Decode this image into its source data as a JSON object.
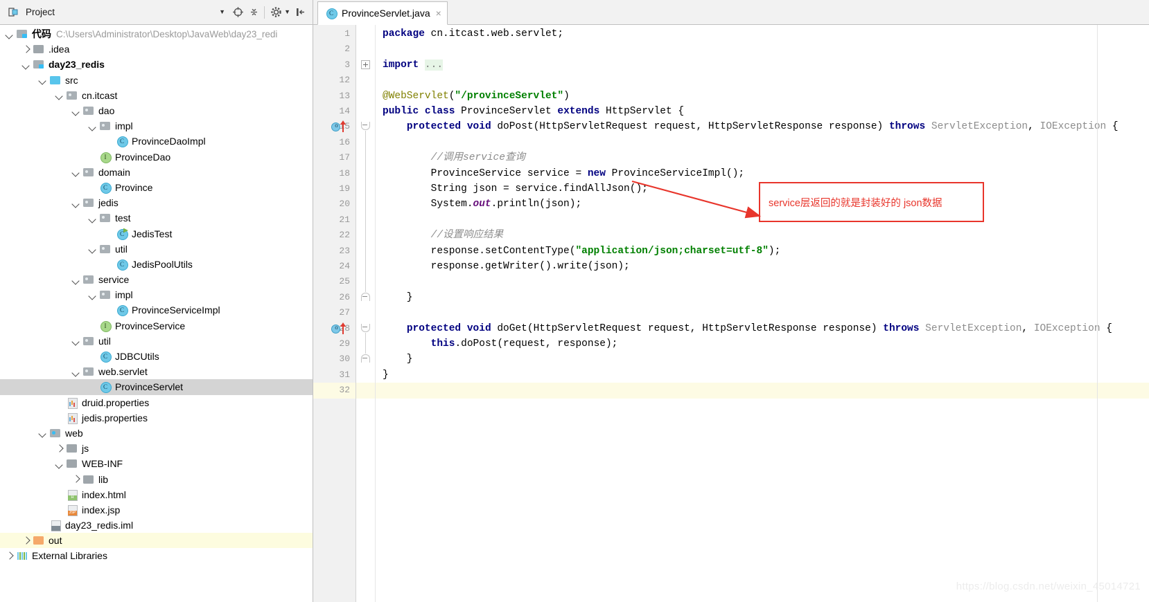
{
  "window": {
    "tool_window_title": "Project",
    "watermark": "https://blog.csdn.net/weixin_45014721"
  },
  "toolbar": {
    "locate_icon": "crosshair-locate-icon",
    "collapse_icon": "collapse-all-icon",
    "settings_icon": "gear-icon",
    "hide_icon": "hide-tool-window-icon",
    "caret_icon": "chevron-down-icon"
  },
  "tabs": [
    {
      "label": "ProvinceServlet.java",
      "icon": "java-class-icon",
      "active": true,
      "close": "×"
    }
  ],
  "tree": [
    {
      "label": "代码",
      "path": "C:\\Users\\Administrator\\Desktop\\JavaWeb\\day23_redi",
      "indent": 0,
      "arrow": "down",
      "icon": "mod",
      "bold": true
    },
    {
      "label": ".idea",
      "indent": 1,
      "arrow": "right",
      "icon": "folder"
    },
    {
      "label": "day23_redis",
      "indent": 1,
      "arrow": "down",
      "icon": "mod",
      "bold": true
    },
    {
      "label": "src",
      "indent": 2,
      "arrow": "down",
      "icon": "srcfolder"
    },
    {
      "label": "cn.itcast",
      "indent": 3,
      "arrow": "down",
      "icon": "pkg"
    },
    {
      "label": "dao",
      "indent": 4,
      "arrow": "down",
      "icon": "pkg"
    },
    {
      "label": "impl",
      "indent": 5,
      "arrow": "down",
      "icon": "pkg"
    },
    {
      "label": "ProvinceDaoImpl",
      "indent": 6,
      "arrow": "none",
      "icon": "cls"
    },
    {
      "label": "ProvinceDao",
      "indent": 5,
      "arrow": "none",
      "icon": "iface"
    },
    {
      "label": "domain",
      "indent": 4,
      "arrow": "down",
      "icon": "pkg"
    },
    {
      "label": "Province",
      "indent": 5,
      "arrow": "none",
      "icon": "cls"
    },
    {
      "label": "jedis",
      "indent": 4,
      "arrow": "down",
      "icon": "pkg"
    },
    {
      "label": "test",
      "indent": 5,
      "arrow": "down",
      "icon": "pkg"
    },
    {
      "label": "JedisTest",
      "indent": 6,
      "arrow": "none",
      "icon": "clsrun"
    },
    {
      "label": "util",
      "indent": 5,
      "arrow": "down",
      "icon": "pkg"
    },
    {
      "label": "JedisPoolUtils",
      "indent": 6,
      "arrow": "none",
      "icon": "cls"
    },
    {
      "label": "service",
      "indent": 4,
      "arrow": "down",
      "icon": "pkg"
    },
    {
      "label": "impl",
      "indent": 5,
      "arrow": "down",
      "icon": "pkg"
    },
    {
      "label": "ProvinceServiceImpl",
      "indent": 6,
      "arrow": "none",
      "icon": "cls"
    },
    {
      "label": "ProvinceService",
      "indent": 5,
      "arrow": "none",
      "icon": "iface"
    },
    {
      "label": "util",
      "indent": 4,
      "arrow": "down",
      "icon": "pkg"
    },
    {
      "label": "JDBCUtils",
      "indent": 5,
      "arrow": "none",
      "icon": "cls"
    },
    {
      "label": "web.servlet",
      "indent": 4,
      "arrow": "down",
      "icon": "pkg"
    },
    {
      "label": "ProvinceServlet",
      "indent": 5,
      "arrow": "none",
      "icon": "cls",
      "state": "selected"
    },
    {
      "label": "druid.properties",
      "indent": 3,
      "arrow": "none",
      "icon": "props"
    },
    {
      "label": "jedis.properties",
      "indent": 3,
      "arrow": "none",
      "icon": "props"
    },
    {
      "label": "web",
      "indent": 2,
      "arrow": "down",
      "icon": "webfolder"
    },
    {
      "label": "js",
      "indent": 3,
      "arrow": "right",
      "icon": "folder"
    },
    {
      "label": "WEB-INF",
      "indent": 3,
      "arrow": "down",
      "icon": "folder"
    },
    {
      "label": "lib",
      "indent": 4,
      "arrow": "right",
      "icon": "folder"
    },
    {
      "label": "index.html",
      "indent": 3,
      "arrow": "none",
      "icon": "doc-h"
    },
    {
      "label": "index.jsp",
      "indent": 3,
      "arrow": "none",
      "icon": "doc-jsp"
    },
    {
      "label": "day23_redis.iml",
      "indent": 2,
      "arrow": "none",
      "icon": "doc-iml"
    },
    {
      "label": "out",
      "indent": 1,
      "arrow": "right",
      "icon": "outfolder",
      "state": "highlight"
    },
    {
      "label": "External Libraries",
      "indent": 0,
      "arrow": "right",
      "icon": "libs"
    }
  ],
  "editor": {
    "line_numbers": [
      1,
      2,
      3,
      12,
      13,
      14,
      15,
      16,
      17,
      18,
      19,
      20,
      21,
      22,
      23,
      24,
      25,
      26,
      27,
      28,
      29,
      30,
      31,
      32
    ],
    "caret_line": 32,
    "override_markers": [
      15,
      28
    ],
    "lines": [
      {
        "n": 1,
        "text": "package cn.itcast.web.servlet;"
      },
      {
        "n": 2,
        "text": ""
      },
      {
        "n": 3,
        "text": "import ..."
      },
      {
        "n": 12,
        "text": ""
      },
      {
        "n": 13,
        "text": "@WebServlet(\"/provinceServlet\")"
      },
      {
        "n": 14,
        "text": "public class ProvinceServlet extends HttpServlet {"
      },
      {
        "n": 15,
        "text": "    protected void doPost(HttpServletRequest request, HttpServletResponse response) throws ServletException, IOException {"
      },
      {
        "n": 16,
        "text": ""
      },
      {
        "n": 17,
        "text": "        //调用service查询"
      },
      {
        "n": 18,
        "text": "        ProvinceService service = new ProvinceServiceImpl();"
      },
      {
        "n": 19,
        "text": "        String json = service.findAllJson();"
      },
      {
        "n": 20,
        "text": "        System.out.println(json);"
      },
      {
        "n": 21,
        "text": ""
      },
      {
        "n": 22,
        "text": "        //设置响应结果"
      },
      {
        "n": 23,
        "text": "        response.setContentType(\"application/json;charset=utf-8\");"
      },
      {
        "n": 24,
        "text": "        response.getWriter().write(json);"
      },
      {
        "n": 25,
        "text": ""
      },
      {
        "n": 26,
        "text": "    }"
      },
      {
        "n": 27,
        "text": ""
      },
      {
        "n": 28,
        "text": "    protected void doGet(HttpServletRequest request, HttpServletResponse response) throws ServletException, IOException {"
      },
      {
        "n": 29,
        "text": "        this.doPost(request, response);"
      },
      {
        "n": 30,
        "text": "    }"
      },
      {
        "n": 31,
        "text": "}"
      },
      {
        "n": 32,
        "text": ""
      }
    ]
  },
  "annotation": {
    "text": "service层返回的就是封装好的 json数据",
    "color": "#e8352b"
  },
  "colors": {
    "keyword": "#000080",
    "string": "#008000",
    "annotation": "#808000",
    "comment": "#8c8c8c",
    "static_field": "#660e7a",
    "selection": "#d4d4d4",
    "caret_line": "#fdfbe4",
    "accent_red": "#e8352b"
  }
}
